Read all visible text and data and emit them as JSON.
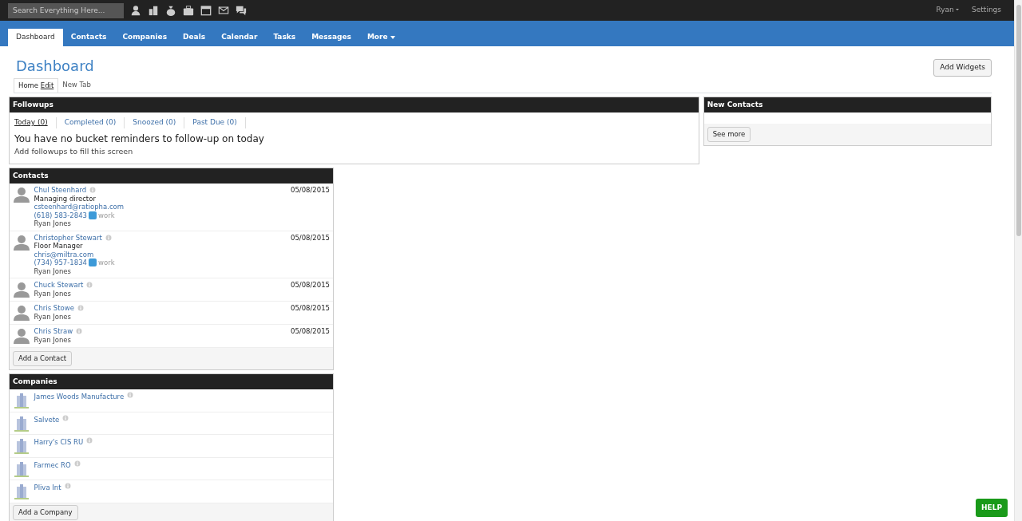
{
  "topbar": {
    "search": {
      "placeholder": "Search Everything Here..."
    },
    "user": "Ryan",
    "settings": "Settings"
  },
  "nav": [
    {
      "label": "Dashboard",
      "selected": true
    },
    {
      "label": "Contacts",
      "selected": false
    },
    {
      "label": "Companies",
      "selected": false
    },
    {
      "label": "Deals",
      "selected": false
    },
    {
      "label": "Calendar",
      "selected": false
    },
    {
      "label": "Tasks",
      "selected": false
    },
    {
      "label": "Messages",
      "selected": false
    },
    {
      "label": "More",
      "selected": false,
      "dropdown": true
    }
  ],
  "page": {
    "title": "Dashboard",
    "add_widgets": "Add Widgets",
    "subtabs": [
      {
        "label": "Home",
        "edit": "Edit",
        "selected": true
      },
      {
        "label": "New Tab",
        "selected": false
      }
    ]
  },
  "followups": {
    "title": "Followups",
    "filters": [
      {
        "label": "Today (0)",
        "selected": true
      },
      {
        "label": "Completed (0)",
        "selected": false
      },
      {
        "label": "Snoozed (0)",
        "selected": false
      },
      {
        "label": "Past Due (0)",
        "selected": false
      }
    ],
    "message": "You have no bucket reminders to follow-up on today",
    "hint": "Add followups to fill this screen"
  },
  "contacts": {
    "title": "Contacts",
    "rows": [
      {
        "name": "Chul Steenhard",
        "title": "Managing director",
        "email": "csteenhard@ratiopha.com",
        "phone": "(618) 583-2843",
        "phone_label": "work",
        "owner": "Ryan Jones",
        "date": "05/08/2015"
      },
      {
        "name": "Christopher Stewart",
        "title": "Floor Manager",
        "email": "chris@miltra.com",
        "phone": "(734) 957-1834",
        "phone_label": "work",
        "owner": "Ryan Jones",
        "date": "05/08/2015"
      },
      {
        "name": "Chuck Stewart",
        "owner": "Ryan Jones",
        "date": "05/08/2015"
      },
      {
        "name": "Chris Stowe",
        "owner": "Ryan Jones",
        "date": "05/08/2015"
      },
      {
        "name": "Chris Straw",
        "owner": "Ryan Jones",
        "date": "05/08/2015"
      }
    ],
    "button": "Add a Contact"
  },
  "companies": {
    "title": "Companies",
    "rows": [
      "James Woods Manufacture",
      "Salvete",
      "Harry's CIS RU",
      "Farmec RO",
      "Pliva Int"
    ],
    "button": "Add a Company"
  },
  "new_contacts": {
    "title": "New Contacts",
    "button": "See more"
  },
  "help": "HELP"
}
